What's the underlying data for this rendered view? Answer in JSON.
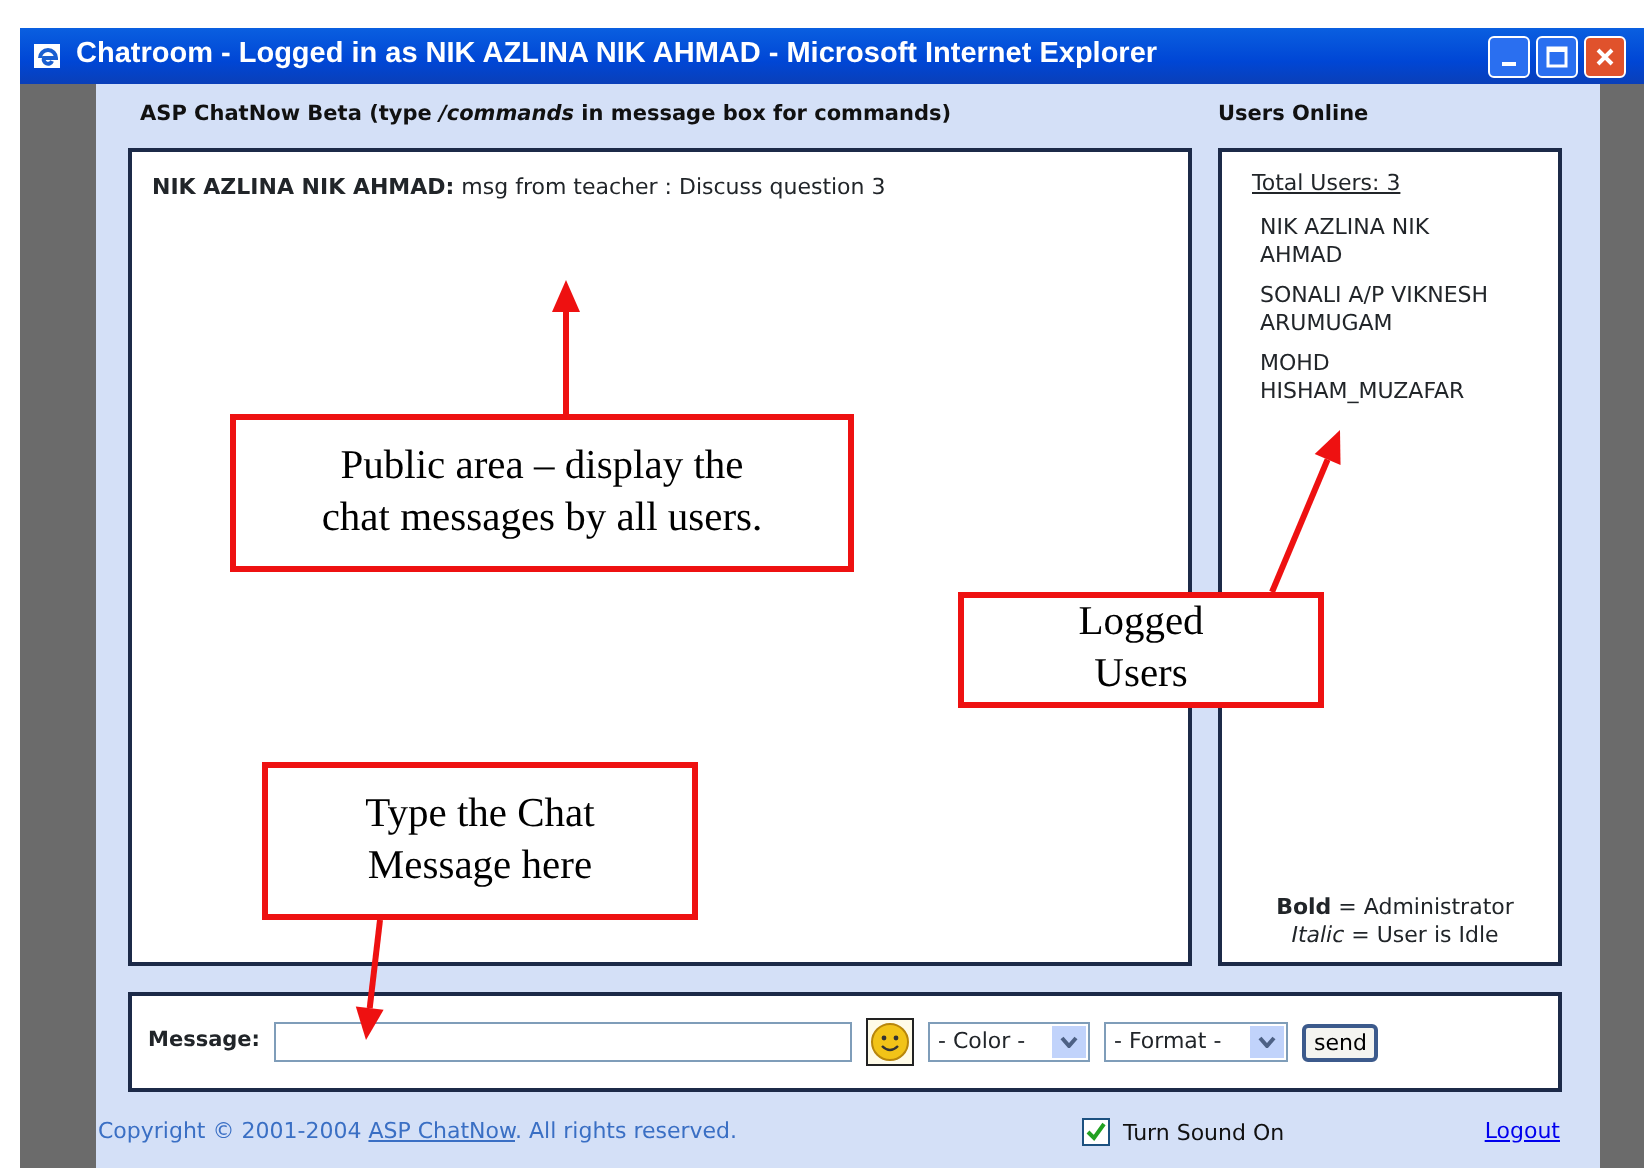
{
  "window": {
    "title": "Chatroom - Logged in as NIK AZLINA NIK AHMAD - Microsoft Internet Explorer"
  },
  "chat": {
    "heading": "ASP ChatNow Beta (type */commands* in message box for commands)",
    "messages": [
      {
        "text": "**NIK AZLINA NIK AHMAD:** msg from teacher : Discuss question 3"
      }
    ]
  },
  "users": {
    "heading": "Users Online",
    "total": "Total Users: 3",
    "list": [
      {
        "name": "NIK AZLINA NIK AHMAD"
      },
      {
        "name": "SONALI A/P VIKNESH ARUMUGAM"
      },
      {
        "name": "MOHD HISHAM_MUZAFAR"
      }
    ],
    "legend": [
      "**Bold** = Administrator",
      "*Italic* = User is Idle"
    ]
  },
  "message_bar": {
    "label": "Message:",
    "color_select": "- Color -",
    "format_select": "- Format -",
    "send": "send"
  },
  "footer": {
    "copyright_before": "Copyright © 2001-2004",
    "link": "ASP ChatNow",
    "copyright_after": ". All rights reserved.",
    "sound": {
      "label": "Turn Sound On",
      "checked": true
    },
    "logout": "Logout"
  },
  "callouts": [
    {
      "text": "Public area – display the chat messages by all users."
    },
    {
      "text": "Logged Users"
    },
    {
      "text": "Type the Chat Message here"
    }
  ]
}
